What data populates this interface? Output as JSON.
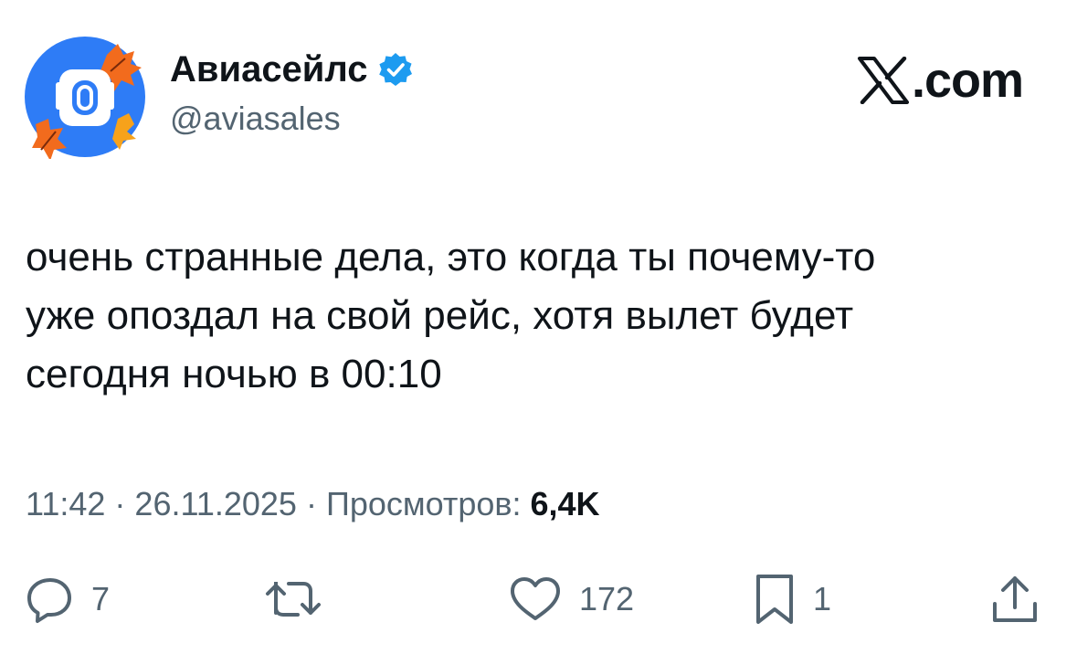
{
  "author": {
    "display_name": "Авиасейлс",
    "handle": "@aviasales",
    "verified": true,
    "verified_color": "#1d9bf0",
    "avatar_bg": "#2e7cf6"
  },
  "brand": {
    "label": ".com",
    "icon": "x-logo-icon"
  },
  "tweet": {
    "lines": [
      "очень странные дела, это когда ты почему-то",
      "уже опоздал на свой рейс, хотя вылет будет",
      "сегодня ночью в 00:10"
    ]
  },
  "meta": {
    "time": "11:42",
    "separator": " · ",
    "date": "26.11.2025",
    "views_label": "Просмотров:",
    "views_count": "6,4K"
  },
  "actions": {
    "reply": {
      "icon": "reply-icon",
      "count": "7"
    },
    "retweet": {
      "icon": "retweet-icon",
      "count": ""
    },
    "like": {
      "icon": "heart-icon",
      "count": "172"
    },
    "bookmark": {
      "icon": "bookmark-icon",
      "count": "1"
    },
    "share": {
      "icon": "share-icon",
      "count": ""
    }
  }
}
